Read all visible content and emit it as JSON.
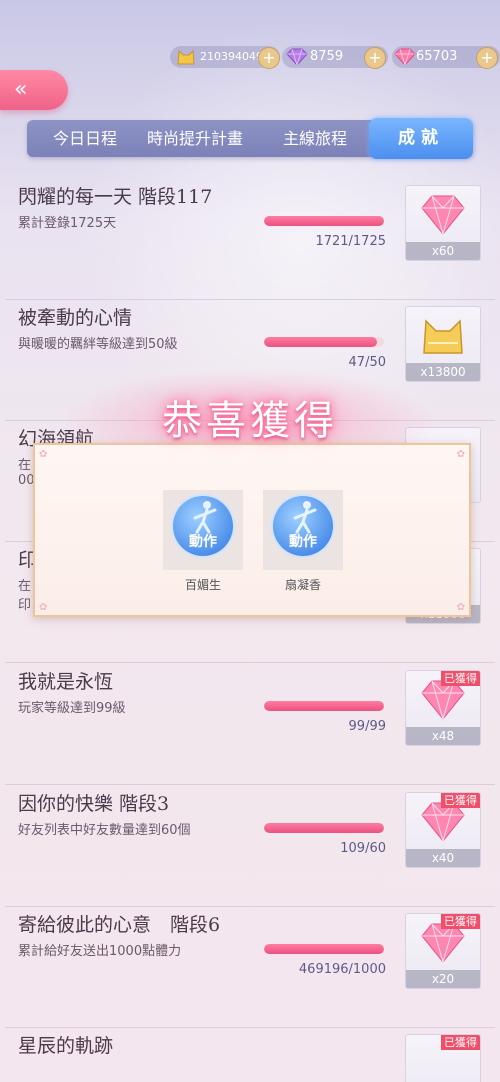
{
  "currency": [
    {
      "icon": "cat-coin-icon",
      "value": "210394049"
    },
    {
      "icon": "purple-diamond-icon",
      "value": "8759"
    },
    {
      "icon": "pink-diamond-icon",
      "value": "65703"
    }
  ],
  "back_label": "«",
  "tabs": [
    "今日日程",
    "時尚提升計畫",
    "主線旅程",
    "成就"
  ],
  "active_tab": 3,
  "colors": {
    "accent_pink": "#ef5b86",
    "tab_bar": "#8389bf",
    "active_tab": "#5a9bf3",
    "badge": "#ef4f6a"
  },
  "achievements": [
    {
      "title": "閃耀的每一天 階段117",
      "desc": "累計登錄1725天",
      "count": "1721/1725",
      "progress": 0.998,
      "reward_icon": "pink-diamond-icon",
      "reward_qty": "x60",
      "badge": ""
    },
    {
      "title": "被牽動的心情",
      "desc": "與暖暖的羈絆等級達到50級",
      "count": "47/50",
      "progress": 0.94,
      "reward_icon": "gold-cat-coin-icon",
      "reward_qty": "x13800",
      "badge": ""
    },
    {
      "title": "幻海領航",
      "desc": "在",
      "desc2": "00",
      "count": "",
      "progress": 0,
      "reward_icon": "pink-diamond-icon",
      "reward_qty": "",
      "badge": ""
    },
    {
      "title": "印",
      "desc": "在",
      "desc2": "印",
      "count": "",
      "progress": 0,
      "reward_icon": "pink-diamond-icon",
      "reward_qty": "x11800",
      "badge": ""
    },
    {
      "title": "我就是永恆",
      "desc": "玩家等級達到99級",
      "count": "99/99",
      "progress": 1.0,
      "reward_icon": "pink-diamond-icon",
      "reward_qty": "x48",
      "badge": "已獲得"
    },
    {
      "title": "因你的快樂 階段3",
      "desc": "好友列表中好友數量達到60個",
      "count": "109/60",
      "progress": 1.0,
      "reward_icon": "pink-diamond-icon",
      "reward_qty": "x40",
      "badge": "已獲得"
    },
    {
      "title": "寄給彼此的心意　階段6",
      "desc": "累計給好友送出1000點體力",
      "count": "469196/1000",
      "progress": 1.0,
      "reward_icon": "pink-diamond-icon",
      "reward_qty": "x20",
      "badge": "已獲得"
    },
    {
      "title": "星辰的軌跡",
      "desc": "",
      "count": "",
      "progress": 0,
      "reward_icon": "pink-diamond-icon",
      "reward_qty": "",
      "badge": "已獲得"
    }
  ],
  "popup": {
    "title": "恭喜獲得",
    "items": [
      {
        "label": "動作",
        "name": "百媚生",
        "icon": "dance-pose-icon"
      },
      {
        "label": "動作",
        "name": "扇凝香",
        "icon": "dance-pose-icon"
      }
    ]
  }
}
